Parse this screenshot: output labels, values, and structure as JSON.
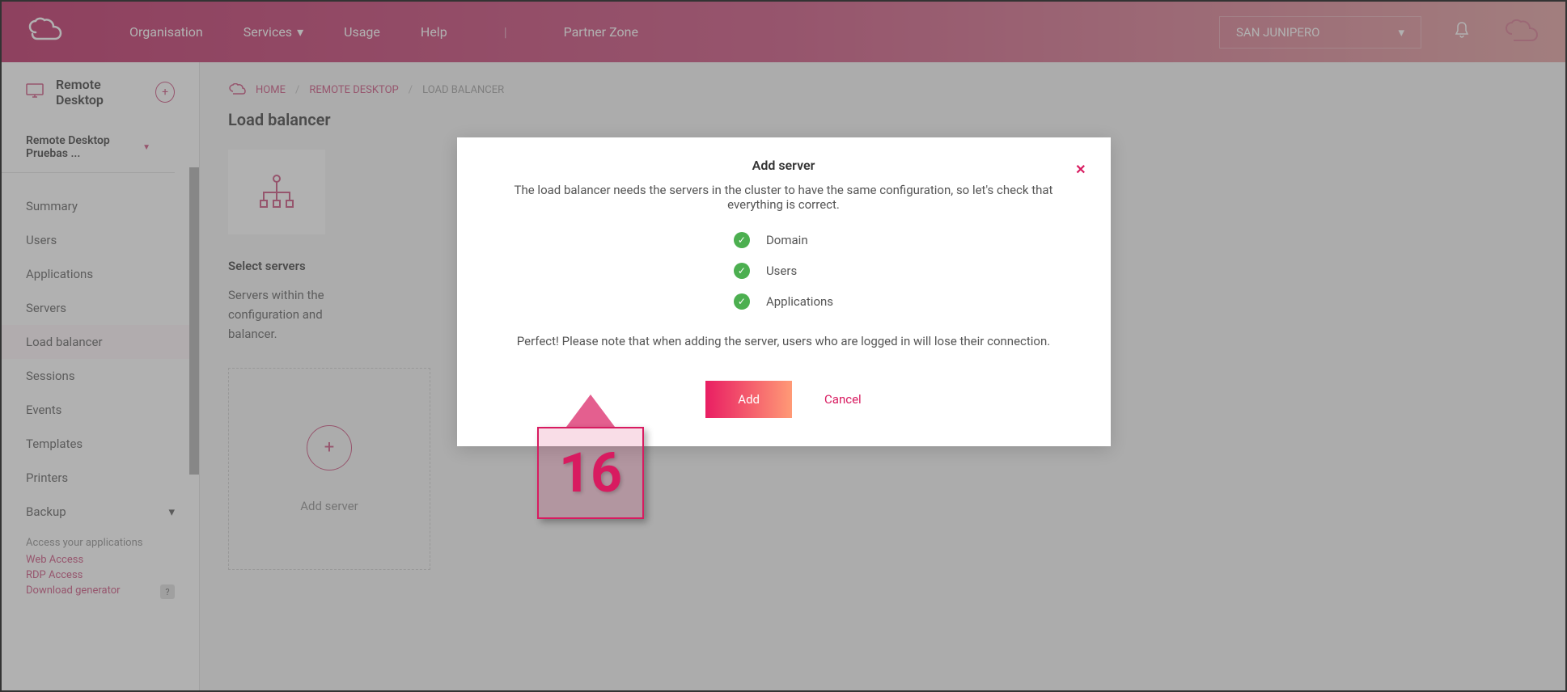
{
  "header": {
    "nav": {
      "organisation": "Organisation",
      "services": "Services",
      "usage": "Usage",
      "help": "Help",
      "partner_zone": "Partner Zone"
    },
    "org_selected": "SAN JUNIPERO"
  },
  "sidebar": {
    "title": "Remote Desktop",
    "subtitle": "Remote Desktop Pruebas ...",
    "menu": {
      "summary": "Summary",
      "users": "Users",
      "applications": "Applications",
      "servers": "Servers",
      "load_balancer": "Load balancer",
      "sessions": "Sessions",
      "events": "Events",
      "templates": "Templates",
      "printers": "Printers",
      "backup": "Backup"
    },
    "footer": {
      "label": "Access your applications",
      "web_access": "Web Access",
      "rdp_access": "RDP Access",
      "download_gen": "Download generator",
      "help": "?"
    }
  },
  "breadcrumb": {
    "home": "HOME",
    "remote_desktop": "REMOTE DESKTOP",
    "current": "LOAD BALANCER"
  },
  "page": {
    "title": "Load balancer",
    "section_title": "Select servers",
    "section_desc1": "Servers within the",
    "section_desc2": "configuration and",
    "section_desc3": "balancer.",
    "add_server_label": "Add server"
  },
  "modal": {
    "title": "Add server",
    "desc": "The load balancer needs the servers in the cluster to have the same configuration, so let's check that everything is correct.",
    "check_domain": "Domain",
    "check_users": "Users",
    "check_applications": "Applications",
    "note": "Perfect! Please note that when adding the server, users who are logged in will lose their connection.",
    "add_btn": "Add",
    "cancel_btn": "Cancel"
  },
  "callout": {
    "number": "16"
  }
}
